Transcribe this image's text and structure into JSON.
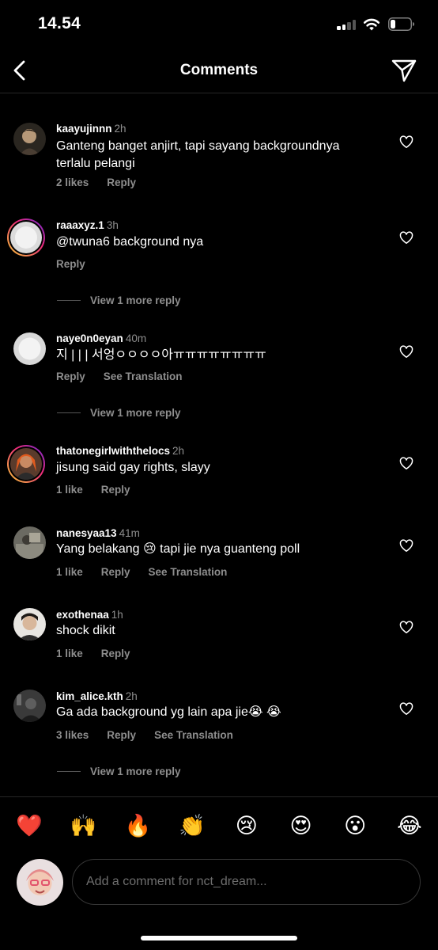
{
  "status": {
    "time": "14.54",
    "signal_bars": 2,
    "battery_level": 0.25
  },
  "header": {
    "title": "Comments",
    "back_icon": "chevron-left-icon",
    "send_icon": "paper-plane-icon"
  },
  "comments": [
    {
      "username": "kaayujinnn",
      "age": "2h",
      "text": "Ganteng banget anjirt, tapi sayang backgroundnya terlalu pelangi",
      "likes": "2 likes",
      "reply": "Reply"
    },
    {
      "username": "raaaxyz.1",
      "age": "3h",
      "text": "@twuna6 background nya",
      "reply": "Reply",
      "more_replies": "View 1 more reply"
    },
    {
      "username": "naye0n0eyan",
      "age": "40m",
      "text": "지 | | | 서엉ㅇㅇㅇㅇ아ㅠㅠㅠㅠㅠㅠㅠㅠ",
      "reply": "Reply",
      "translate": "See Translation",
      "more_replies": "View 1 more reply"
    },
    {
      "username": "thatonegirlwiththelocs",
      "age": "2h",
      "text": "jisung said gay rights, slayy",
      "likes": "1 like",
      "reply": "Reply"
    },
    {
      "username": "nanesyaa13",
      "age": "41m",
      "text": "Yang belakang 😢  tapi jie nya guanteng poll",
      "likes": "1 like",
      "reply": "Reply",
      "translate": "See Translation"
    },
    {
      "username": "exothenaa",
      "age": "1h",
      "text": "shock dikit",
      "likes": "1 like",
      "reply": "Reply"
    },
    {
      "username": "kim_alice.kth",
      "age": "2h",
      "text": "Ga ada background yg lain apa jie😭 😭",
      "likes": "3 likes",
      "reply": "Reply",
      "translate": "See Translation",
      "more_replies": "View 1 more reply"
    }
  ],
  "reactions": [
    "❤️",
    "🙌",
    "🔥",
    "👏",
    "😢",
    "😍",
    "😮",
    "😂"
  ],
  "input": {
    "placeholder": "Add a comment for nct_dream..."
  },
  "colors": {
    "background": "#000000",
    "secondary_text": "#8e8e8e",
    "divider": "#262626"
  }
}
